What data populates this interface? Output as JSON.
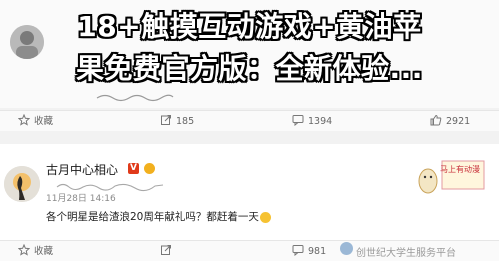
{
  "overlay": {
    "title_line1": "18+触摸互动游戏+黄油苹",
    "title_line2": "果免费官方版：全新体验..."
  },
  "top_post": {
    "actions": [
      {
        "label": "收藏",
        "icon": "star-icon"
      },
      {
        "label": "185",
        "icon": "share-icon"
      },
      {
        "label": "1394",
        "icon": "comment-icon"
      },
      {
        "label": "2921",
        "icon": "like-icon"
      }
    ]
  },
  "bottom_post": {
    "username": "古月中心相心",
    "vip_badge": "V",
    "timestamp": "11月28日 14:16",
    "text": "各个明星是给渣浪20周年献礼吗？都赶着一天",
    "actions": [
      {
        "label": "收藏",
        "icon": "star-icon"
      },
      {
        "label": "",
        "icon": "share-icon"
      },
      {
        "label": "981",
        "icon": "comment-icon"
      }
    ]
  },
  "sticker": {
    "text": "马上有动漫"
  },
  "watermark": {
    "text": "创世纪大学生服务平台"
  },
  "colors": {
    "vip_red": "#e03a1a",
    "badge_gold": "#f2b01e",
    "sticker_red": "#c8303a"
  }
}
